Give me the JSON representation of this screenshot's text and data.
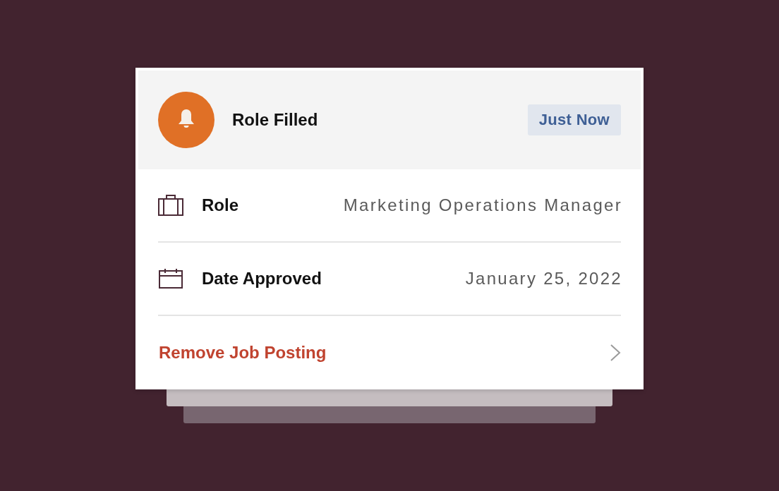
{
  "notification": {
    "title": "Role Filled",
    "time": "Just Now"
  },
  "details": [
    {
      "kind": "role",
      "label": "Role",
      "value": "Marketing Operations Manager"
    },
    {
      "kind": "date",
      "label": "Date Approved",
      "value": "January 25, 2022"
    }
  ],
  "action": {
    "label": "Remove Job Posting"
  }
}
